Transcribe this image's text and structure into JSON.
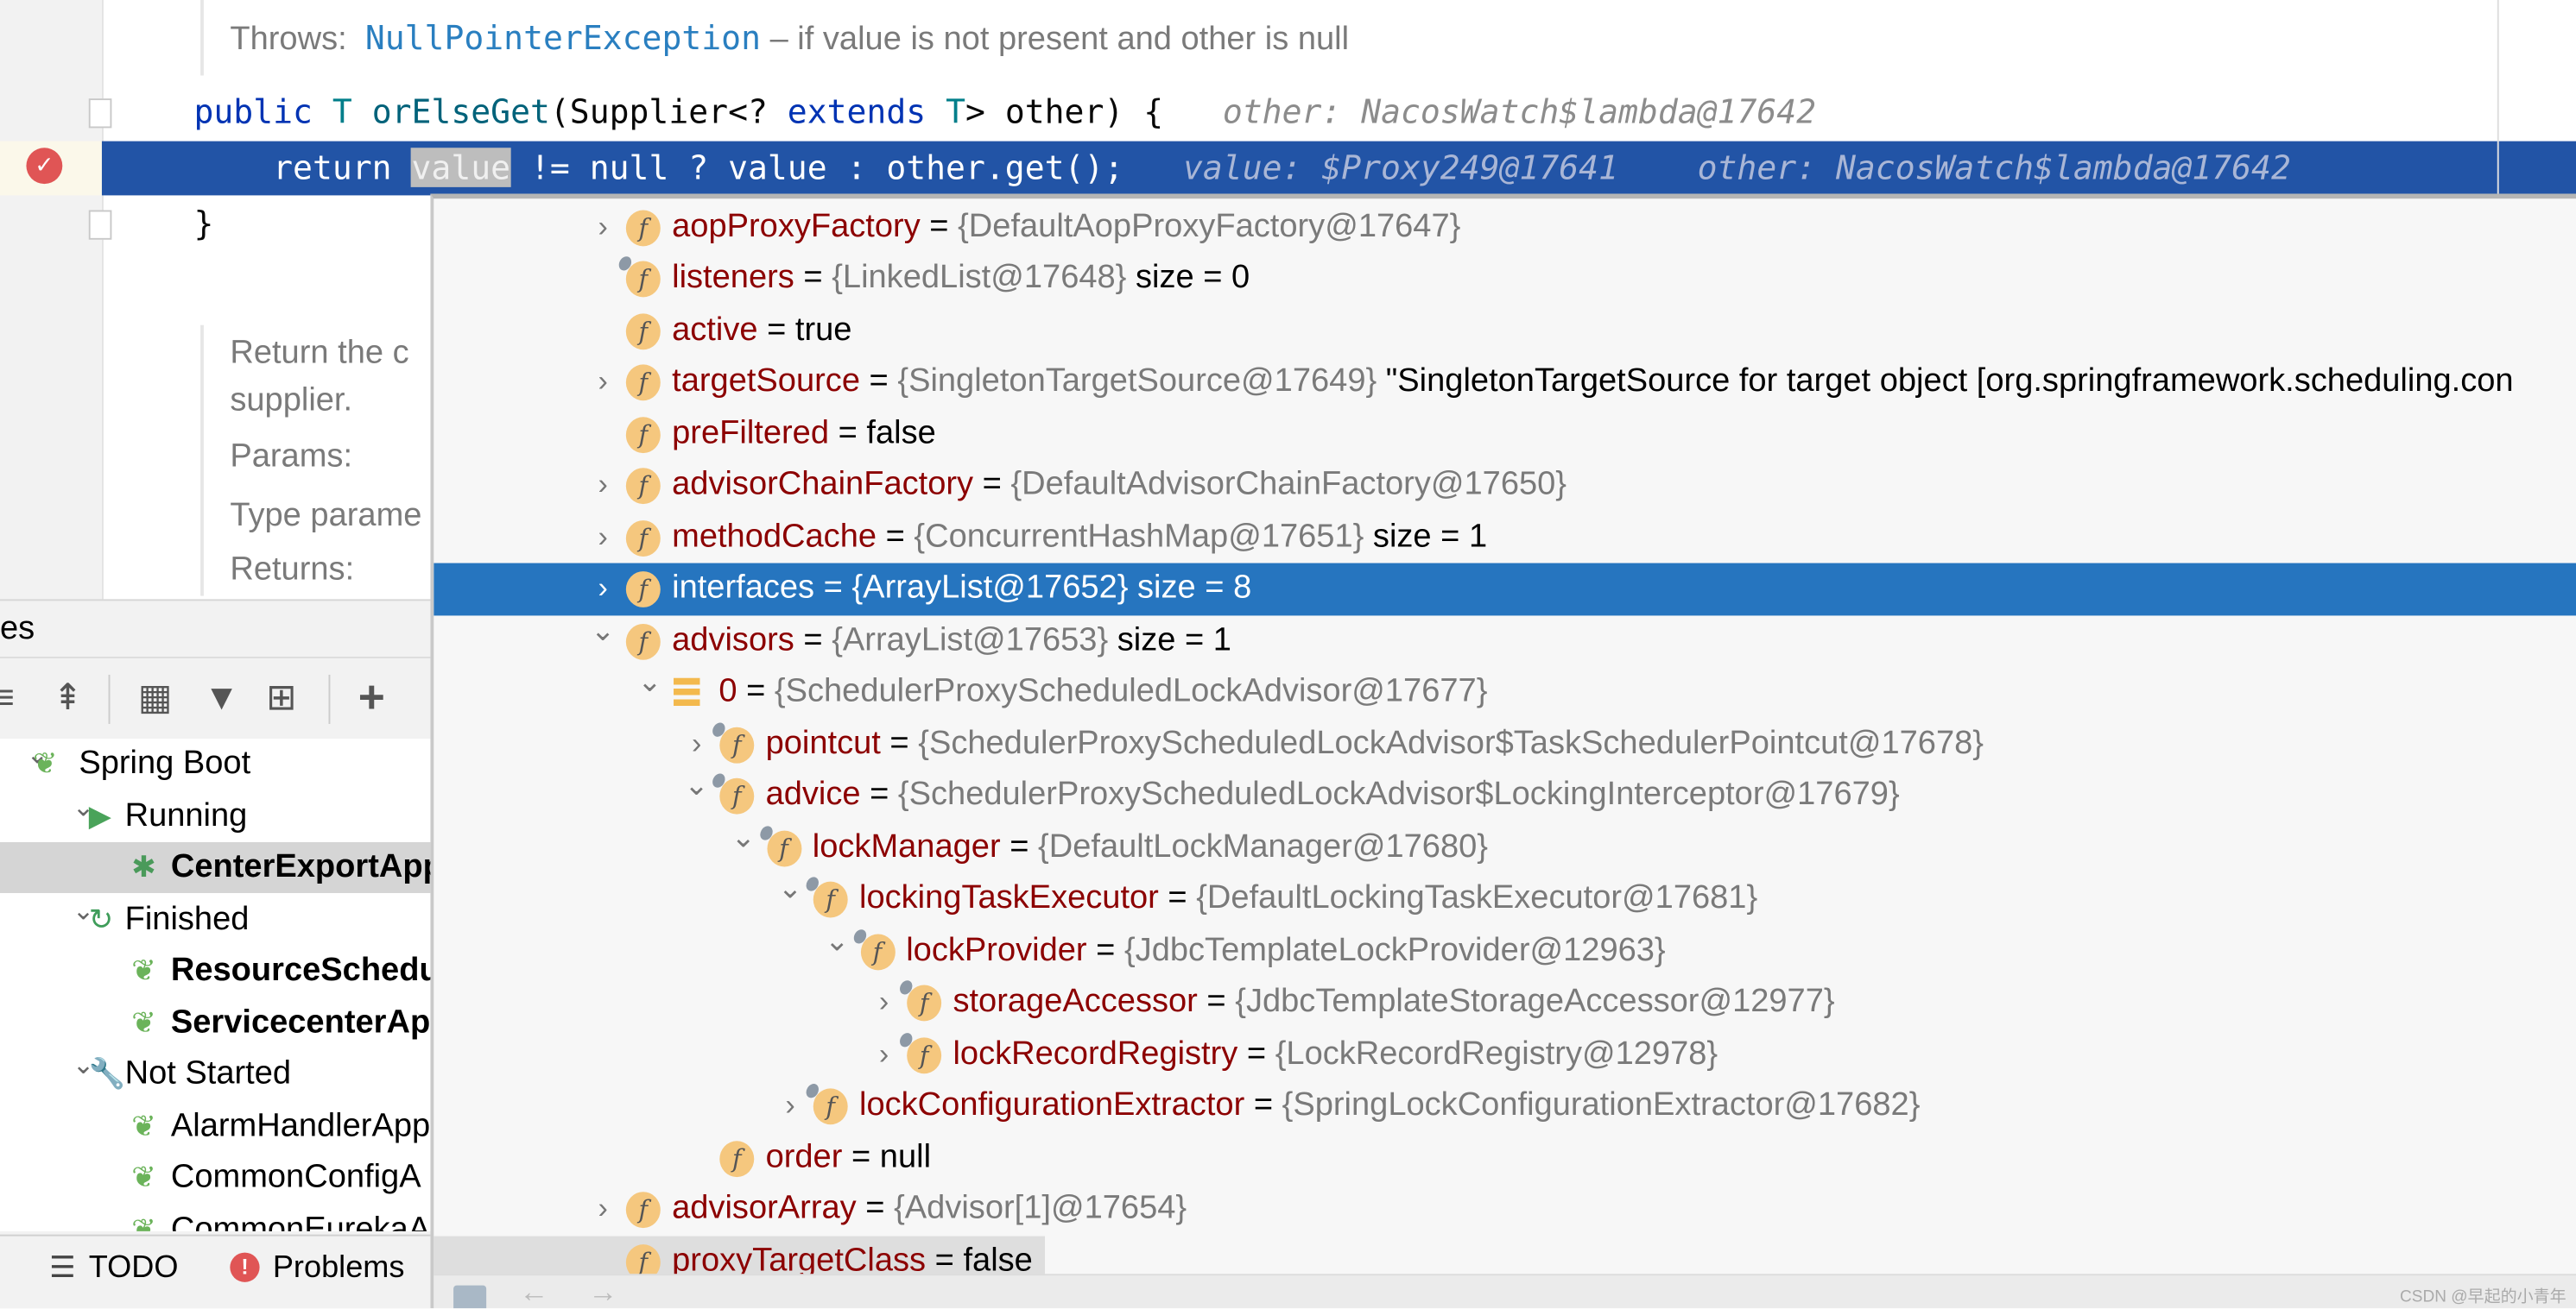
{
  "editor": {
    "throws_label": "Throws:",
    "throws_exception": "NullPointerException",
    "throws_desc": " – if value is not present and other is null",
    "sig": {
      "kw_public": "public",
      "type_T": "T",
      "method": "orElseGet",
      "open": "(Supplier<? ",
      "kw_extends": "extends",
      "type_T2": "T",
      "close": "> other) {",
      "hint": "other: NacosWatch$lambda@17642"
    },
    "ret": {
      "kw_return": "return ",
      "value_hl": "value",
      "rest": " != null ? value : other.get();",
      "hint_value": "value: $Proxy249@17641",
      "hint_other": "other: NacosWatch$lambda@17642"
    },
    "close_brace": "}",
    "doc_lines": [
      "Return the c",
      "supplier.",
      "Params:",
      "Type parame",
      "Returns:"
    ]
  },
  "left_panel": {
    "title": "es",
    "toolbar": [
      {
        "icon": "expand-all-icon",
        "glyph": "≡"
      },
      {
        "icon": "collapse-all-icon",
        "glyph": "⇞"
      },
      {
        "icon": "group-icon",
        "glyph": "▦"
      },
      {
        "icon": "filter-icon",
        "glyph": "▼"
      },
      {
        "icon": "new-tab-icon",
        "glyph": "⊞"
      },
      {
        "icon": "add-icon",
        "glyph": "+"
      }
    ],
    "tree": [
      {
        "label": "Spring Boot",
        "level": 0,
        "arrow": "expanded",
        "icon": "spring-boot-icon",
        "bold": false,
        "selected": false
      },
      {
        "label": "Running",
        "level": 1,
        "arrow": "expanded",
        "icon": "run-icon",
        "bold": false,
        "selected": false
      },
      {
        "label": "CenterExportApp",
        "level": 2,
        "arrow": "none",
        "icon": "debug-icon",
        "bold": true,
        "selected": true
      },
      {
        "label": "Finished",
        "level": 1,
        "arrow": "expanded",
        "icon": "rerun-icon",
        "bold": false,
        "selected": false
      },
      {
        "label": "ResourceSchedu",
        "level": 2,
        "arrow": "none",
        "icon": "spring-boot-icon",
        "bold": true,
        "selected": false
      },
      {
        "label": "ServicecenterAp",
        "level": 2,
        "arrow": "none",
        "icon": "spring-boot-icon",
        "bold": true,
        "selected": false
      },
      {
        "label": "Not Started",
        "level": 1,
        "arrow": "expanded",
        "icon": "wrench-icon",
        "bold": false,
        "selected": false
      },
      {
        "label": "AlarmHandlerApp",
        "level": 2,
        "arrow": "none",
        "icon": "spring-boot-icon",
        "bold": false,
        "selected": false
      },
      {
        "label": "CommonConfigA",
        "level": 2,
        "arrow": "none",
        "icon": "spring-boot-icon",
        "bold": false,
        "selected": false
      },
      {
        "label": "CommonEurekaA",
        "level": 2,
        "arrow": "none",
        "icon": "spring-boot-icon",
        "bold": false,
        "selected": false
      }
    ],
    "bottom_tabs": [
      {
        "label": "TODO",
        "icon": "list-icon"
      },
      {
        "label": "Problems",
        "icon": "error-icon"
      }
    ]
  },
  "popup": {
    "rows": [
      {
        "level": 0,
        "arrow": "collapsed",
        "icon": "field",
        "pin": false,
        "name": "aopProxyFactory",
        "value": "{DefaultAopProxyFactory@17647}",
        "literal": false,
        "extra": ""
      },
      {
        "level": 0,
        "arrow": "none",
        "icon": "field",
        "pin": true,
        "name": "listeners",
        "value": "{LinkedList@17648}",
        "literal": false,
        "extra": "size = 0"
      },
      {
        "level": 0,
        "arrow": "none",
        "icon": "field",
        "pin": false,
        "name": "active",
        "value": "true",
        "literal": true,
        "extra": ""
      },
      {
        "level": 0,
        "arrow": "collapsed",
        "icon": "field",
        "pin": false,
        "name": "targetSource",
        "value": "{SingletonTargetSource@17649}",
        "literal": false,
        "extra": "\"SingletonTargetSource for target object [org.springframework.scheduling.con"
      },
      {
        "level": 0,
        "arrow": "none",
        "icon": "field",
        "pin": false,
        "name": "preFiltered",
        "value": "false",
        "literal": true,
        "extra": ""
      },
      {
        "level": 0,
        "arrow": "collapsed",
        "icon": "field",
        "pin": false,
        "name": "advisorChainFactory",
        "value": "{DefaultAdvisorChainFactory@17650}",
        "literal": false,
        "extra": ""
      },
      {
        "level": 0,
        "arrow": "collapsed",
        "icon": "field",
        "pin": false,
        "name": "methodCache",
        "value": "{ConcurrentHashMap@17651}",
        "literal": false,
        "extra": "size = 1"
      },
      {
        "level": 0,
        "arrow": "collapsed",
        "icon": "field",
        "pin": false,
        "name": "interfaces",
        "value": "{ArrayList@17652}",
        "literal": false,
        "extra": "size = 8",
        "selected": true
      },
      {
        "level": 0,
        "arrow": "expanded",
        "icon": "field",
        "pin": false,
        "name": "advisors",
        "value": "{ArrayList@17653}",
        "literal": false,
        "extra": "size = 1"
      },
      {
        "level": 1,
        "arrow": "expanded",
        "icon": "array-item",
        "pin": false,
        "name": "0",
        "value": "{SchedulerProxyScheduledLockAdvisor@17677}",
        "literal": false,
        "extra": ""
      },
      {
        "level": 2,
        "arrow": "collapsed",
        "icon": "field",
        "pin": true,
        "name": "pointcut",
        "value": "{SchedulerProxyScheduledLockAdvisor$TaskSchedulerPointcut@17678}",
        "literal": false,
        "extra": ""
      },
      {
        "level": 2,
        "arrow": "expanded",
        "icon": "field",
        "pin": true,
        "name": "advice",
        "value": "{SchedulerProxyScheduledLockAdvisor$LockingInterceptor@17679}",
        "literal": false,
        "extra": ""
      },
      {
        "level": 3,
        "arrow": "expanded",
        "icon": "field",
        "pin": true,
        "name": "lockManager",
        "value": "{DefaultLockManager@17680}",
        "literal": false,
        "extra": ""
      },
      {
        "level": 4,
        "arrow": "expanded",
        "icon": "field",
        "pin": true,
        "name": "lockingTaskExecutor",
        "value": "{DefaultLockingTaskExecutor@17681}",
        "literal": false,
        "extra": ""
      },
      {
        "level": 5,
        "arrow": "expanded",
        "icon": "field",
        "pin": true,
        "name": "lockProvider",
        "value": "{JdbcTemplateLockProvider@12963}",
        "literal": false,
        "extra": ""
      },
      {
        "level": 6,
        "arrow": "collapsed",
        "icon": "field",
        "pin": true,
        "name": "storageAccessor",
        "value": "{JdbcTemplateStorageAccessor@12977}",
        "literal": false,
        "extra": ""
      },
      {
        "level": 6,
        "arrow": "collapsed",
        "icon": "field",
        "pin": true,
        "name": "lockRecordRegistry",
        "value": "{LockRecordRegistry@12978}",
        "literal": false,
        "extra": ""
      },
      {
        "level": 4,
        "arrow": "collapsed",
        "icon": "field",
        "pin": true,
        "name": "lockConfigurationExtractor",
        "value": "{SpringLockConfigurationExtractor@17682}",
        "literal": false,
        "extra": ""
      },
      {
        "level": 2,
        "arrow": "none",
        "icon": "field",
        "pin": false,
        "name": "order",
        "value": "null",
        "literal": true,
        "extra": ""
      },
      {
        "level": 0,
        "arrow": "collapsed",
        "icon": "field",
        "pin": false,
        "name": "advisorArray",
        "value": "{Advisor[1]@17654}",
        "literal": false,
        "extra": ""
      },
      {
        "level": 0,
        "arrow": "none",
        "icon": "field",
        "pin": false,
        "name": "proxyTargetClass",
        "value": "false",
        "literal": true,
        "extra": "",
        "hovered": true
      }
    ],
    "watermark": "CSDN @早起的小青年"
  },
  "colors": {
    "selection": "#2675bf",
    "execution_line": "#2254a6",
    "field_name": "#8c0000",
    "field_icon": "#f5c77e"
  }
}
